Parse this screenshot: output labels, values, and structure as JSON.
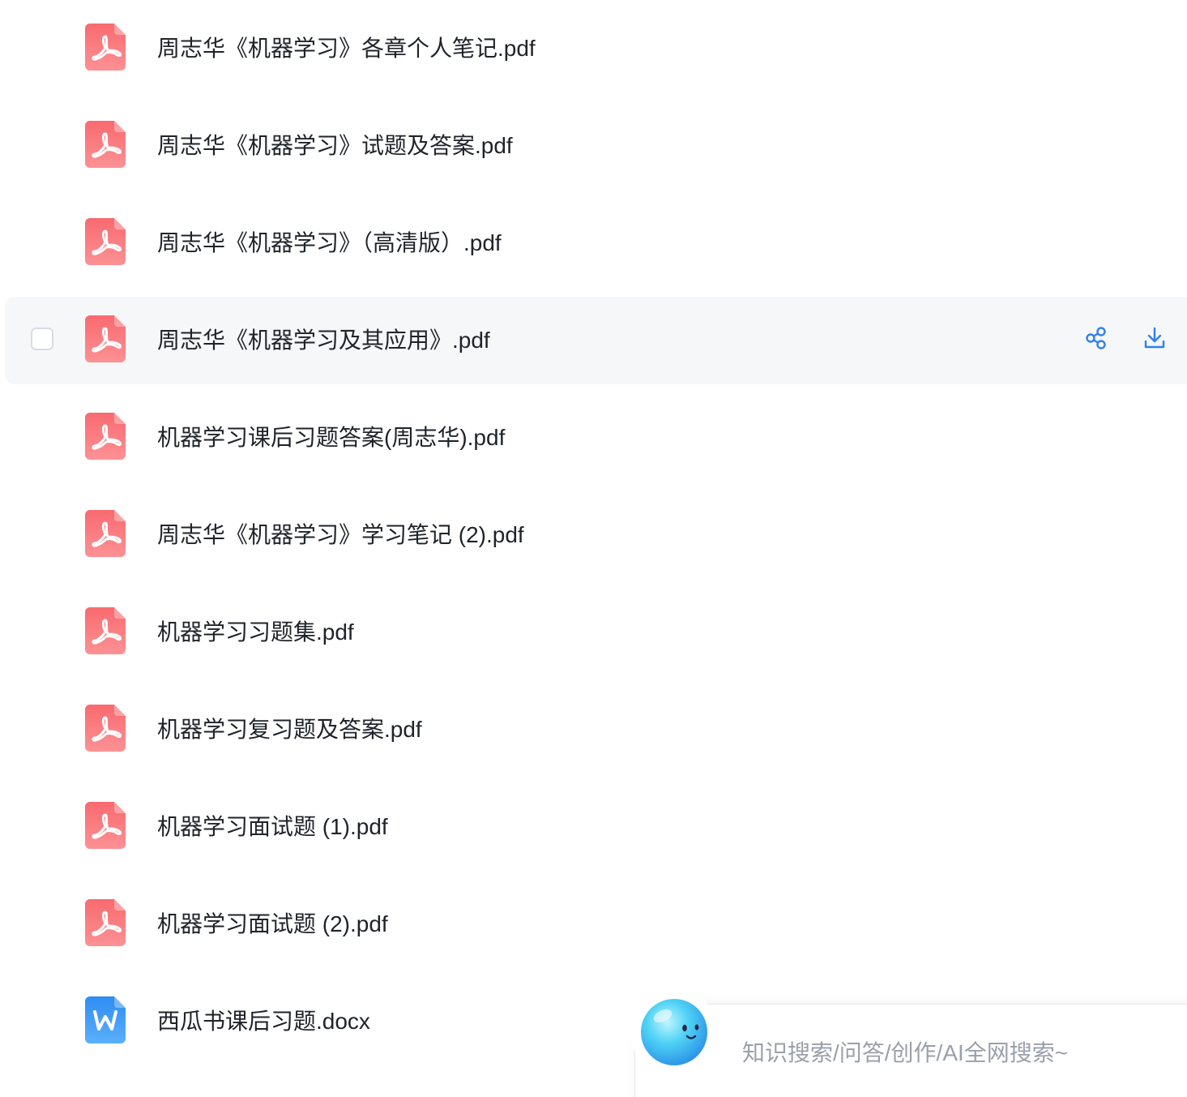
{
  "files": [
    {
      "name": "周志华《机器学习》各章个人笔记.pdf",
      "type": "pdf"
    },
    {
      "name": "周志华《机器学习》试题及答案.pdf",
      "type": "pdf"
    },
    {
      "name": "周志华《机器学习》（高清版）.pdf",
      "type": "pdf"
    },
    {
      "name": "周志华《机器学习及其应用》.pdf",
      "type": "pdf"
    },
    {
      "name": "机器学习课后习题答案(周志华).pdf",
      "type": "pdf"
    },
    {
      "name": "周志华《机器学习》学习笔记 (2).pdf",
      "type": "pdf"
    },
    {
      "name": "机器学习习题集.pdf",
      "type": "pdf"
    },
    {
      "name": "机器学习复习题及答案.pdf",
      "type": "pdf"
    },
    {
      "name": "机器学习面试题 (1).pdf",
      "type": "pdf"
    },
    {
      "name": "机器学习面试题 (2).pdf",
      "type": "pdf"
    },
    {
      "name": "西瓜书课后习题.docx",
      "type": "docx"
    }
  ],
  "hovered_row": 3,
  "row_actions": {
    "share_icon": "share-icon",
    "download_icon": "download-icon"
  },
  "assistant": {
    "placeholder": "知识搜索/问答/创作/AI全网搜索~"
  },
  "colors": {
    "pdf_icon": "#f7767a",
    "docx_icon": "#3c9bf5",
    "action_icon": "#2f80ed",
    "hover_bg": "#f6f7f9"
  }
}
